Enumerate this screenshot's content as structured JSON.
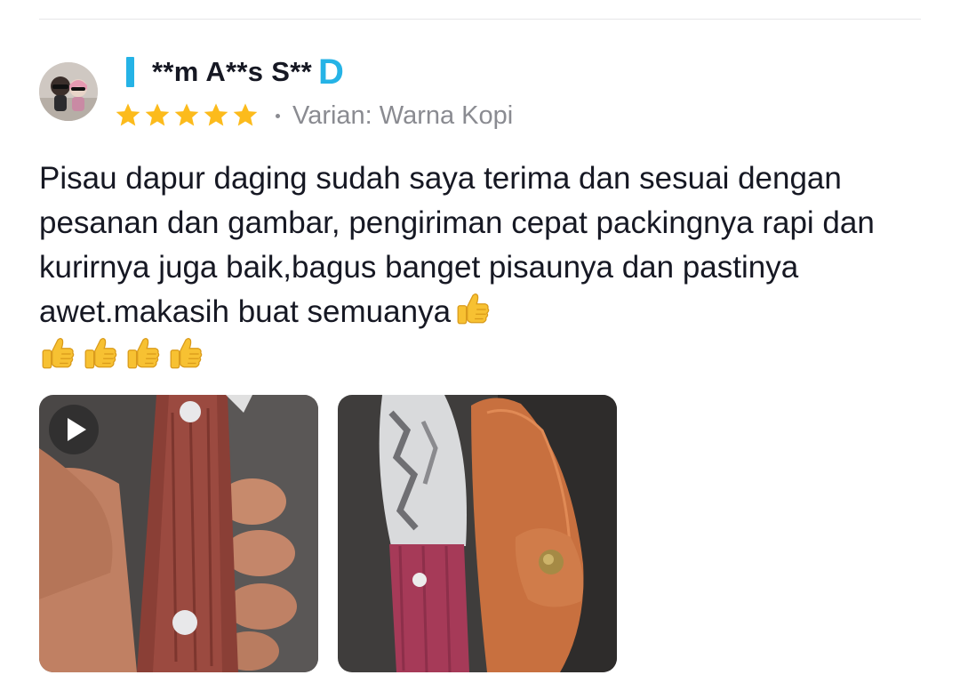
{
  "review": {
    "username": "**m A**s S**",
    "badge": "D",
    "rating": 5,
    "variant_label": "Varian: Warna Kopi",
    "text": "Pisau dapur daging sudah saya terima dan sesuai dengan pesanan dan gambar, pengiriman cepat packingnya rapi dan kurirnya juga baik,bagus banget pisaunya dan pastinya awet.makasih buat semuanya",
    "emoji_icon": "thumbs-up-icon",
    "emoji_count": 5,
    "media": [
      {
        "type": "video",
        "icon": "play-icon"
      },
      {
        "type": "image"
      }
    ]
  },
  "colors": {
    "accent": "#25b3e6",
    "star": "#fcbb1c",
    "secondary_text": "#8a8b91",
    "primary_text": "#161823"
  }
}
